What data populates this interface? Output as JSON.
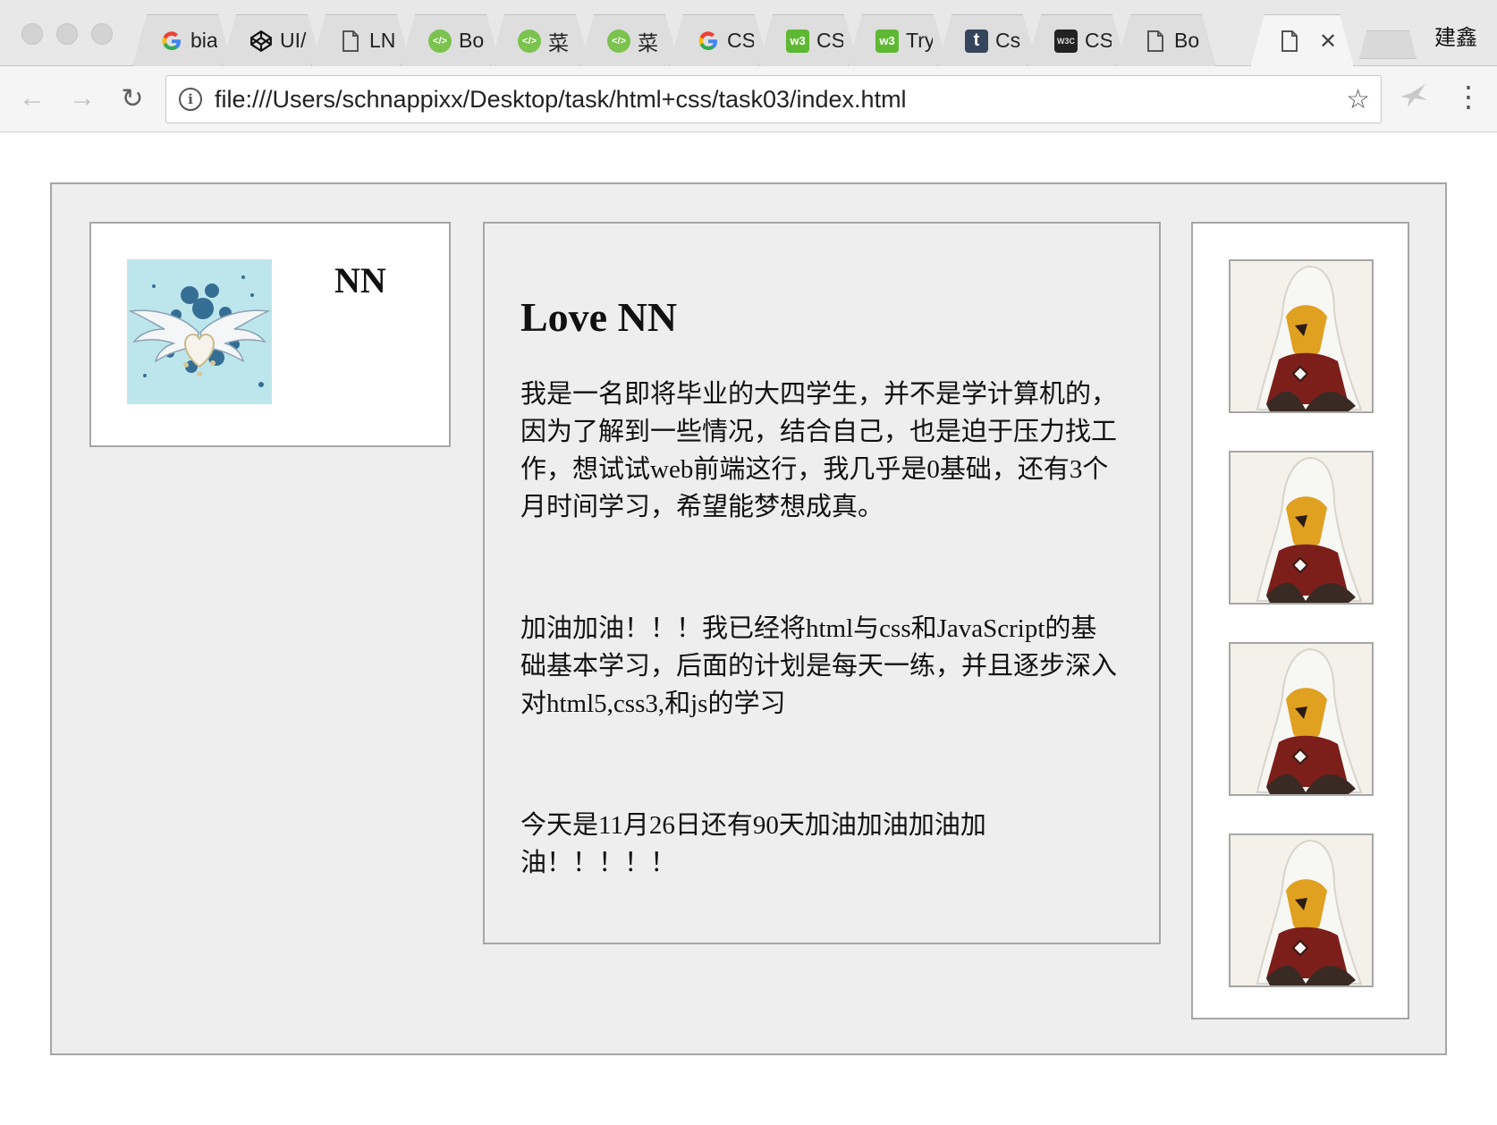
{
  "browser": {
    "tabs": [
      {
        "label": "bia",
        "icon": "google-icon"
      },
      {
        "label": "UI/",
        "icon": "codepen-icon"
      },
      {
        "label": "LN",
        "icon": "document-icon"
      },
      {
        "label": "Bo",
        "icon": "code-icon"
      },
      {
        "label": "菜",
        "icon": "code-icon"
      },
      {
        "label": "菜",
        "icon": "code-icon"
      },
      {
        "label": "CS",
        "icon": "google-icon"
      },
      {
        "label": "CS",
        "icon": "w3-icon"
      },
      {
        "label": "Try",
        "icon": "w3-icon"
      },
      {
        "label": "Cs",
        "icon": "tumblr-icon"
      },
      {
        "label": "CS",
        "icon": "w3c-icon"
      },
      {
        "label": "Bo",
        "icon": "document-icon"
      },
      {
        "label": "",
        "icon": "document-icon",
        "active": true
      }
    ],
    "profile_name": "建鑫",
    "address": "file:///Users/schnappixx/Desktop/task/html+css/task03/index.html"
  },
  "page": {
    "profile": {
      "name": "NN"
    },
    "main": {
      "title": "Love NN",
      "paragraphs": [
        "我是一名即将毕业的大四学生，并不是学计算机的，因为了解到一些情况，结合自己，也是迫于压力找工作，想试试web前端这行，我几乎是0基础，还有3个月时间学习，希望能梦想成真。",
        "加油加油！！！我已经将html与css和JavaScript的基础基本学习，后面的计划是每天一练，并且逐步深入对html5,css3,和js的学习",
        "今天是11月26日还有90天加油加油加油加油！！！！！"
      ]
    },
    "colors": {
      "page_bg": "#eeeeee",
      "border": "#a6a6a6",
      "avatar_bg": "#bde6ec"
    }
  }
}
